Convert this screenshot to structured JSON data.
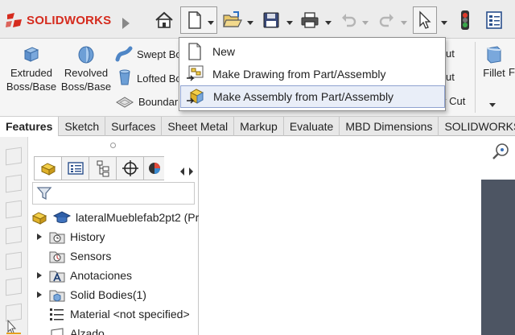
{
  "app": {
    "logo_text": "SOLIDWORKS",
    "brand_color": "#d52b1e"
  },
  "quick_toolbar": {
    "icons": [
      "home-icon",
      "new-document-icon",
      "open-icon",
      "save-icon",
      "print-icon",
      "undo-icon",
      "redo-icon",
      "select-icon",
      "traffic-light-icon",
      "options-icon"
    ]
  },
  "ribbon": {
    "extruded_boss": "Extruded\nBoss/Base",
    "revolved_boss": "Revolved\nBoss/Base",
    "swept_boss": "Swept Bo",
    "lofted_boss": "Lofted Bo",
    "boundary_boss": "Boundar",
    "right_cut_1": "ut",
    "right_cut_2": "ut",
    "right_cut_3": "y Cut",
    "fillet": "Fillet",
    "fillet_trail": "F"
  },
  "new_menu": {
    "items": [
      {
        "label": "New",
        "icon": "blank-document-icon"
      },
      {
        "label": "Make Drawing from Part/Assembly",
        "icon": "drawing-icon"
      },
      {
        "label": "Make Assembly from Part/Assembly",
        "icon": "assembly-icon"
      }
    ],
    "highlighted_index": 2
  },
  "tabs": [
    "Features",
    "Sketch",
    "Surfaces",
    "Sheet Metal",
    "Markup",
    "Evaluate",
    "MBD Dimensions",
    "SOLIDWORKS"
  ],
  "active_tab": "Features",
  "feature_tree": {
    "part_name": "lateralMueblefab2pt2 (Pr",
    "items": [
      {
        "label": "History",
        "expandable": true,
        "icon": "history-icon"
      },
      {
        "label": "Sensors",
        "expandable": false,
        "icon": "sensors-icon"
      },
      {
        "label": "Anotaciones",
        "expandable": true,
        "icon": "annotations-icon"
      },
      {
        "label": "Solid Bodies(1)",
        "expandable": true,
        "icon": "solid-bodies-icon"
      },
      {
        "label": "Material <not specified>",
        "expandable": false,
        "icon": "material-icon"
      },
      {
        "label": "Alzado",
        "expandable": false,
        "icon": "plane-icon"
      }
    ]
  }
}
